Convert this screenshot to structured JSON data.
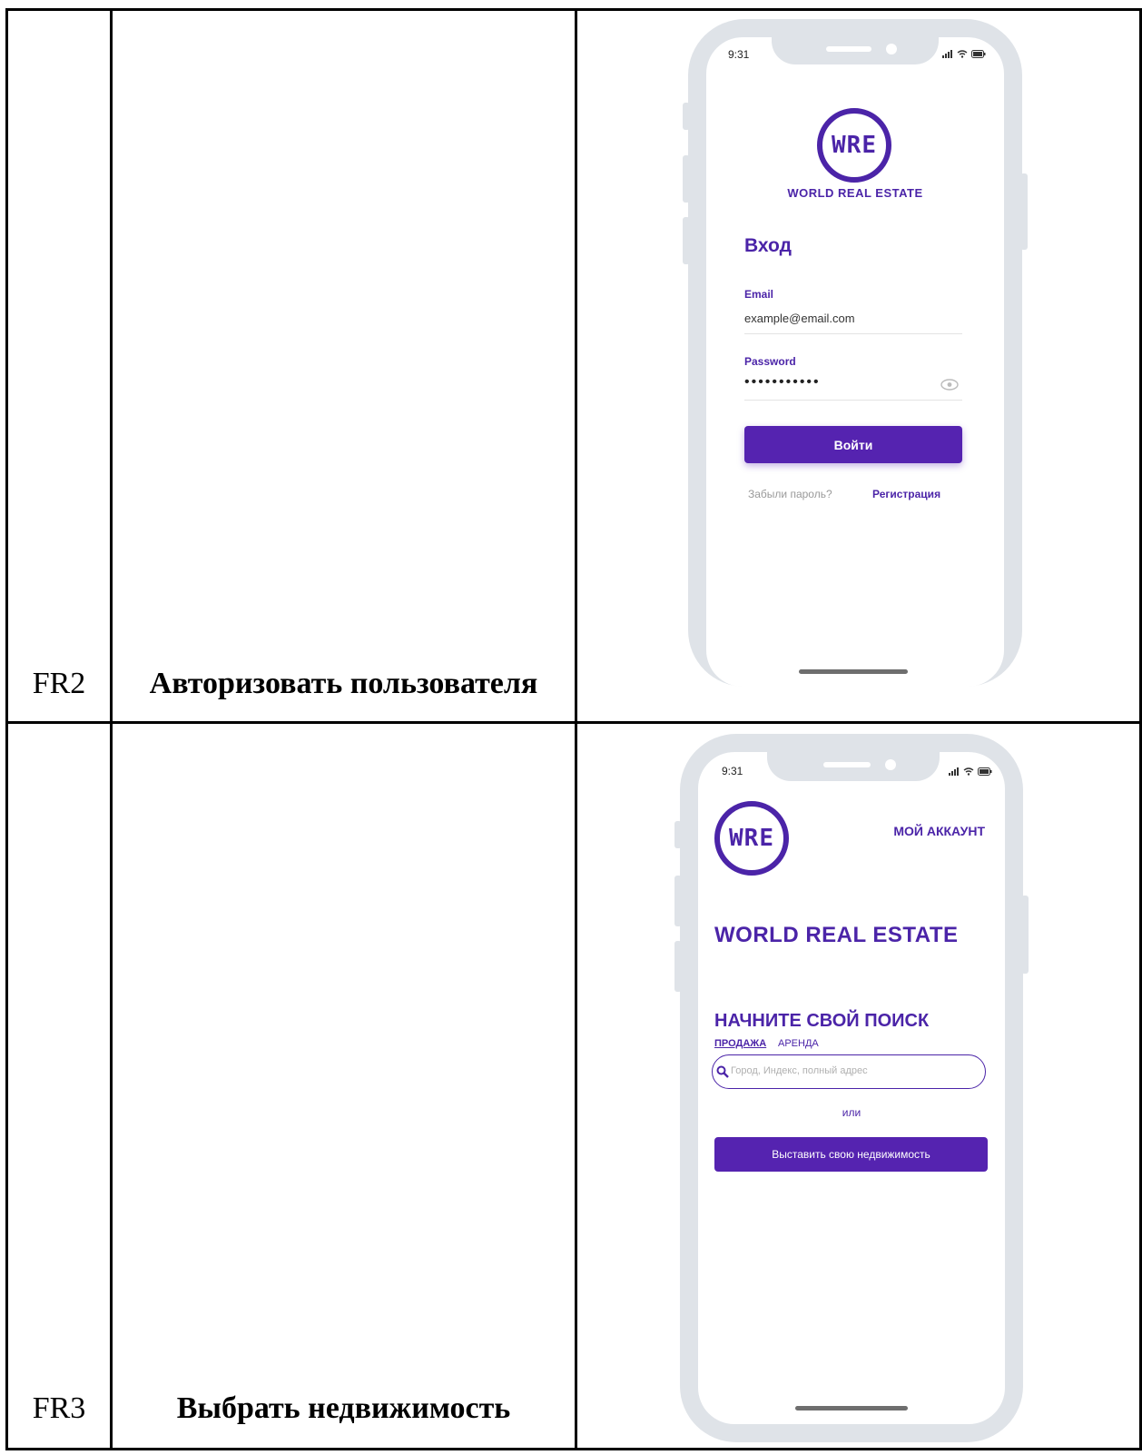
{
  "rows": [
    {
      "id": "FR2",
      "title": "Авторизовать пользователя",
      "phone": {
        "time": "9:31",
        "logo": "WRE",
        "brand": "WORLD REAL ESTATE",
        "heading": "Вход",
        "email_label": "Email",
        "email_value": "example@email.com",
        "password_label": "Password",
        "password_value": "•••••••••••",
        "login_button": "Войти",
        "forgot_link": "Забыли пароль?",
        "register_link": "Регистрация"
      }
    },
    {
      "id": "FR3",
      "title": "Выбрать недвижимость",
      "phone": {
        "time": "9:31",
        "logo": "WRE",
        "account_link": "МОЙ АККАУНТ",
        "brand": "WORLD REAL ESTATE",
        "search_heading": "НАЧНИТЕ СВОЙ ПОИСК",
        "tab_sale": "ПРОДАЖА",
        "tab_rent": "АРЕНДА",
        "search_placeholder": "Город, Индекс, полный адрес",
        "or_text": "или",
        "list_button": "Выставить свою недвижимость"
      }
    }
  ],
  "colors": {
    "accent": "#4b24a8",
    "button": "#5523b0",
    "frame": "#dfe3e8"
  }
}
